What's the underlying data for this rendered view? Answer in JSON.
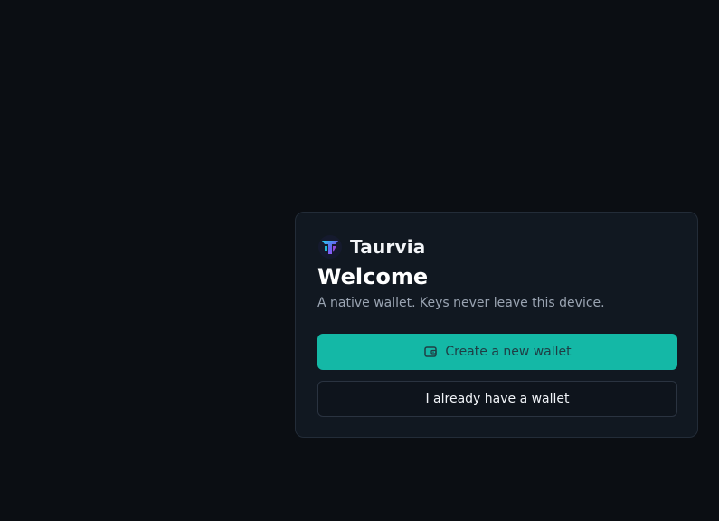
{
  "brand": {
    "name": "Taurvia",
    "logo_icon": "taurvia-logo-icon"
  },
  "welcome": {
    "title": "Welcome",
    "subtitle": "A native wallet. Keys never leave this device."
  },
  "actions": {
    "create_label": "Create a new wallet",
    "create_icon": "wallet-icon",
    "import_label": "I already have a wallet"
  },
  "colors": {
    "background": "#0b0e13",
    "card": "#111821",
    "accent": "#14b8a6"
  }
}
